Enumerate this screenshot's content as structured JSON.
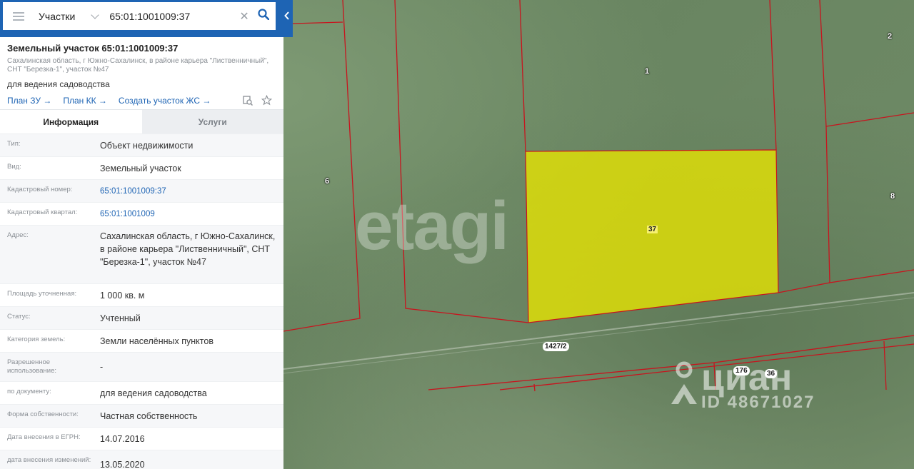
{
  "search": {
    "layer": "Участки",
    "query": "65:01:1001009:37"
  },
  "panel": {
    "title": "Земельный участок 65:01:1001009:37",
    "address": "Сахалинская область, г Южно-Сахалинск, в районе карьера \"Лиственничный\", СНТ \"Березка-1\", участок №47",
    "purpose": "для ведения садоводства",
    "links": [
      "План ЗУ →",
      "План КК →",
      "Создать участок ЖС →"
    ],
    "tabs": [
      "Информация",
      "Услуги"
    ],
    "rows": [
      {
        "key": "Тип:",
        "value": "Объект недвижимости"
      },
      {
        "key": "Вид:",
        "value": "Земельный участок"
      },
      {
        "key": "Кадастровый номер:",
        "value": "65:01:1001009:37"
      },
      {
        "key": "Кадастровый квартал:",
        "value": "65:01:1001009"
      },
      {
        "key": "Адрес:",
        "value": "Сахалинская область, г Южно-Сахалинск, в районе карьера \"Лиственничный\", СНТ \"Березка-1\", участок №47"
      },
      {
        "key": "Площадь уточненная:",
        "value": "1 000 кв. м"
      },
      {
        "key": "Статус:",
        "value": "Учтенный"
      },
      {
        "key": "Категория земель:",
        "value": "Земли населённых пунктов"
      },
      {
        "key": "Разрешенное использование:",
        "value": "-"
      },
      {
        "key": "по документу:",
        "value": "для ведения садоводства"
      },
      {
        "key": "Форма собственности:",
        "value": "Частная собственность"
      },
      {
        "key": "Дата внесения в ЕГРН:",
        "value": "14.07.2016"
      },
      {
        "key": "дата внесения изменений:",
        "value": "13.05.2020"
      }
    ]
  },
  "map": {
    "labels": [
      "1",
      "2",
      "6",
      "8",
      "37",
      "1427/2",
      "176",
      "36"
    ],
    "watermark_etagi": "etagi",
    "watermark_cian": "циан",
    "watermark_id": "ID 48671027",
    "parcel_color": "#e8e600",
    "boundary_color": "#c8141e"
  },
  "colors": {
    "accent": "#1e64b4"
  }
}
